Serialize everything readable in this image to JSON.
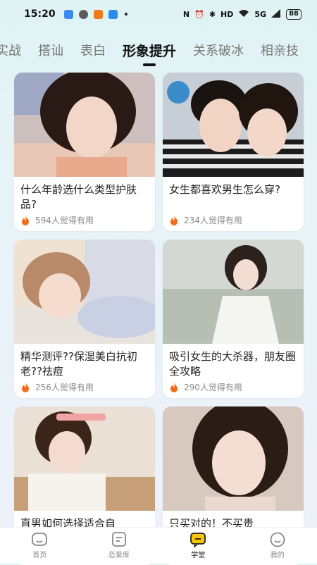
{
  "status_bar": {
    "time": "15:20",
    "network": "5G",
    "battery": "88"
  },
  "tabs": [
    {
      "label": "实战",
      "active": false
    },
    {
      "label": "搭讪",
      "active": false
    },
    {
      "label": "表白",
      "active": false
    },
    {
      "label": "形象提升",
      "active": true
    },
    {
      "label": "关系破冰",
      "active": false
    },
    {
      "label": "相亲技",
      "active": false
    }
  ],
  "cards": [
    {
      "title": "什么年龄选什么类型护肤品?",
      "meta": "594人觉得有用"
    },
    {
      "title": "女生都喜欢男生怎么穿?",
      "meta": "234人觉得有用"
    },
    {
      "title": "精华测评??保湿美白抗初老??祛痘",
      "meta": "256人觉得有用"
    },
    {
      "title": "吸引女生的大杀器，朋友圈全攻略",
      "meta": "290人觉得有用"
    },
    {
      "title": "直男如何选择适合自",
      "meta": ""
    },
    {
      "title": "只买对的！不买贵",
      "meta": ""
    }
  ],
  "bottom_nav": [
    {
      "label": "首页",
      "icon": "home-icon",
      "active": false
    },
    {
      "label": "恋爱库",
      "icon": "library-icon",
      "active": false
    },
    {
      "label": "学堂",
      "icon": "school-icon",
      "active": true
    },
    {
      "label": "我的",
      "icon": "profile-icon",
      "active": false
    }
  ],
  "colors": {
    "accent": "#f7c600",
    "flame": "#f36b1c"
  }
}
